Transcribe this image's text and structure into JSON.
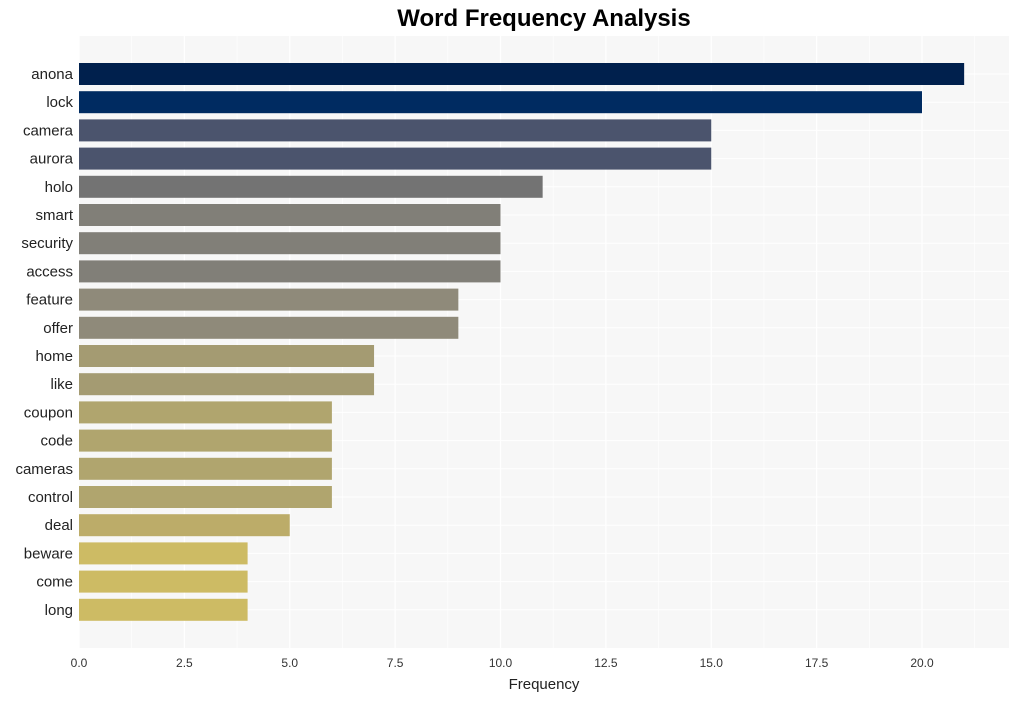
{
  "chart_data": {
    "type": "bar",
    "orientation": "horizontal",
    "title": "Word Frequency Analysis",
    "xlabel": "Frequency",
    "ylabel": "",
    "xlim": [
      0,
      22
    ],
    "xticks": [
      "0.0",
      "2.5",
      "5.0",
      "7.5",
      "10.0",
      "12.5",
      "15.0",
      "17.5",
      "20.0"
    ],
    "xtick_values": [
      0,
      2.5,
      5,
      7.5,
      10,
      12.5,
      15,
      17.5,
      20
    ],
    "grid": true,
    "categories": [
      "anona",
      "lock",
      "camera",
      "aurora",
      "holo",
      "smart",
      "security",
      "access",
      "feature",
      "offer",
      "home",
      "like",
      "coupon",
      "code",
      "cameras",
      "control",
      "deal",
      "beware",
      "come",
      "long"
    ],
    "values": [
      21,
      20,
      15,
      15,
      11,
      10,
      10,
      10,
      9,
      9,
      7,
      7,
      6,
      6,
      6,
      6,
      5,
      4,
      4,
      4
    ],
    "colors": [
      "#00204d",
      "#002b61",
      "#4b546d",
      "#4b546d",
      "#737373",
      "#817f78",
      "#817f78",
      "#817f78",
      "#8f8a7a",
      "#8f8a7a",
      "#a49b72",
      "#a49b72",
      "#b0a56e",
      "#b0a56e",
      "#b0a56e",
      "#b0a56e",
      "#bcac69",
      "#cdbb64",
      "#cdbb64",
      "#cdbb64"
    ]
  }
}
